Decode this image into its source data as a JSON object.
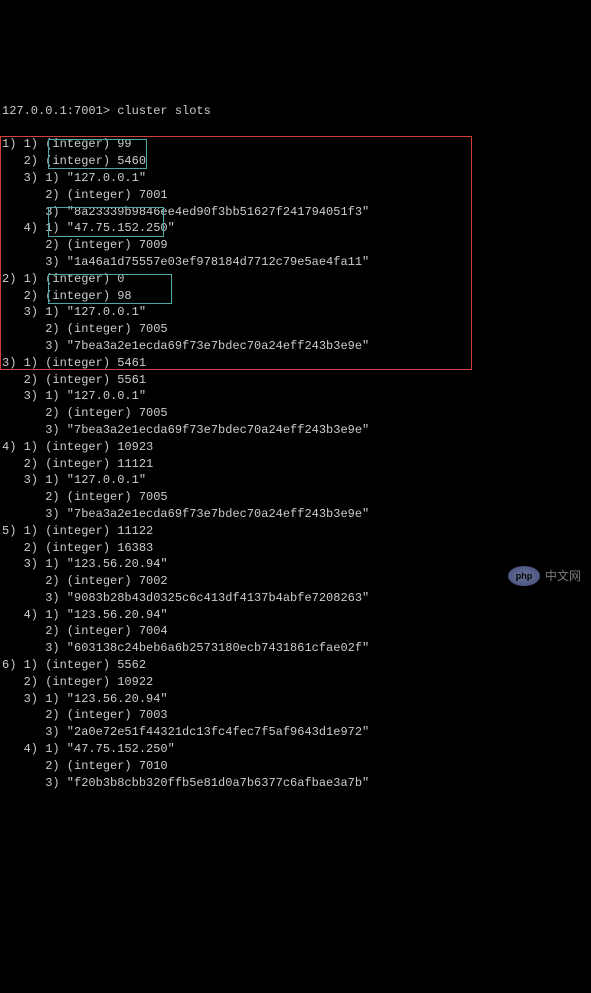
{
  "header_partial": "                                                ",
  "prompt": "127.0.0.1:7001> cluster slots",
  "lines": [
    "1) 1) (integer) 99",
    "   2) (integer) 5460",
    "   3) 1) \"127.0.0.1\"",
    "      2) (integer) 7001",
    "      3) \"8a23339b9846ee4ed90f3bb51627f241794051f3\"",
    "   4) 1) \"47.75.152.250\"",
    "      2) (integer) 7009",
    "      3) \"1a46a1d75557e03ef978184d7712c79e5ae4fa11\"",
    "2) 1) (integer) 0",
    "   2) (integer) 98",
    "   3) 1) \"127.0.0.1\"",
    "      2) (integer) 7005",
    "      3) \"7bea3a2e1ecda69f73e7bdec70a24eff243b3e9e\"",
    "3) 1) (integer) 5461",
    "   2) (integer) 5561",
    "   3) 1) \"127.0.0.1\"",
    "      2) (integer) 7005",
    "      3) \"7bea3a2e1ecda69f73e7bdec70a24eff243b3e9e\"",
    "4) 1) (integer) 10923",
    "   2) (integer) 11121",
    "   3) 1) \"127.0.0.1\"",
    "      2) (integer) 7005",
    "      3) \"7bea3a2e1ecda69f73e7bdec70a24eff243b3e9e\"",
    "5) 1) (integer) 11122",
    "   2) (integer) 16383",
    "   3) 1) \"123.56.20.94\"",
    "      2) (integer) 7002",
    "      3) \"9083b28b43d0325c6c413df4137b4abfe7208263\"",
    "   4) 1) \"123.56.20.94\"",
    "      2) (integer) 7004",
    "      3) \"603138c24beb6a6b2573180ecb7431861cfae02f\"",
    "6) 1) (integer) 5562",
    "   2) (integer) 10922",
    "   3) 1) \"123.56.20.94\"",
    "      2) (integer) 7003",
    "      3) \"2a0e72e51f44321dc13fc4fec7f5af9643d1e972\"",
    "   4) 1) \"47.75.152.250\"",
    "      2) (integer) 7010",
    "      3) \"f20b3b8cbb320ffb5e81d0a7b6377c6afbae3a7b\""
  ],
  "watermark": {
    "logo_text": "php",
    "site_text": "中文网"
  }
}
